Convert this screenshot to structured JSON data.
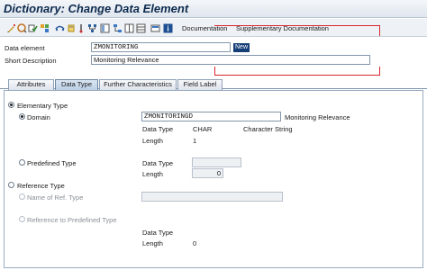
{
  "window": {
    "title": "Dictionary: Change Data Element"
  },
  "toolbar": {
    "icons": [
      "display-change-icon",
      "other-object-icon",
      "check-icon",
      "activate-icon",
      "where-used-icon",
      "object-list-icon",
      "navigate-icon",
      "hierarchy-icon",
      "info-icon"
    ],
    "documentation_label": "Documentation",
    "supplementary_label": "Supplementary Documentation"
  },
  "header": {
    "data_element_label": "Data element",
    "data_element_value": "ZMONITORING",
    "status_badge": "New",
    "short_description_label": "Short Description",
    "short_description_value": "Monitoring Relevance"
  },
  "tabs": [
    {
      "label": "Attributes",
      "active": false
    },
    {
      "label": "Data Type",
      "active": true
    },
    {
      "label": "Further Characteristics",
      "active": false
    },
    {
      "label": "Field Label",
      "active": false
    }
  ],
  "data_type": {
    "elementary": {
      "label": "Elementary Type",
      "domain": {
        "label": "Domain",
        "value": "ZMONITORINGD",
        "description": "Monitoring Relevance",
        "data_type_label": "Data Type",
        "data_type_value": "CHAR",
        "data_type_desc": "Character String",
        "length_label": "Length",
        "length_value": "1"
      },
      "predefined": {
        "label": "Predefined Type",
        "data_type_label": "Data Type",
        "data_type_value": "",
        "length_label": "Length",
        "length_value": "0"
      }
    },
    "reference": {
      "label": "Reference Type",
      "name_of_ref_label": "Name of Ref. Type",
      "name_of_ref_value": "",
      "ref_predefined_label": "Reference to Predefined Type",
      "data_type_label": "Data Type",
      "length_label": "Length",
      "length_value": "0"
    }
  },
  "colors": {
    "title": "#0c2a4e",
    "badge_bg": "#163f78",
    "annotation_red": "#d9262c"
  }
}
